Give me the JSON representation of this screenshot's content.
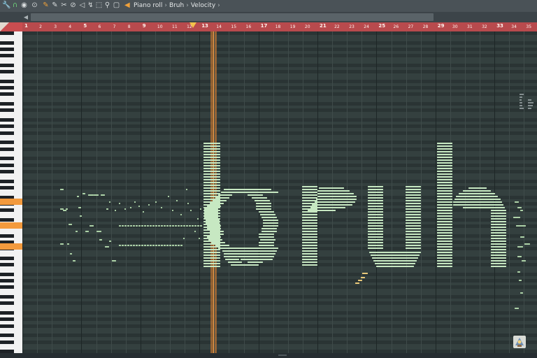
{
  "breadcrumb": {
    "items": [
      "Piano roll",
      "Bruh",
      "Velocity"
    ],
    "separator": "›"
  },
  "toolbar": {
    "icons": [
      "wrench-icon",
      "magnet-icon",
      "record-icon",
      "pencil-icon",
      "brush-icon",
      "delete-icon",
      "mute-icon",
      "slice-icon",
      "select-icon",
      "zoom-icon",
      "playback-icon",
      "speaker-icon"
    ]
  },
  "ruler": {
    "ticks": [
      "1",
      "2",
      "3",
      "4",
      "5",
      "6",
      "7",
      "8",
      "9",
      "10",
      "11",
      "12",
      "13",
      "14",
      "15",
      "16",
      "17",
      "18",
      "19",
      "20",
      "21",
      "22",
      "23",
      "24",
      "25",
      "26",
      "27",
      "28",
      "29",
      "30",
      "31",
      "32",
      "33",
      "34",
      "35"
    ]
  },
  "colors": {
    "note": "#c7e8c2",
    "grid": "#34403f",
    "ruler": "#b84a4d",
    "playhead": "#f4a048",
    "accent": "#f0a13a"
  }
}
